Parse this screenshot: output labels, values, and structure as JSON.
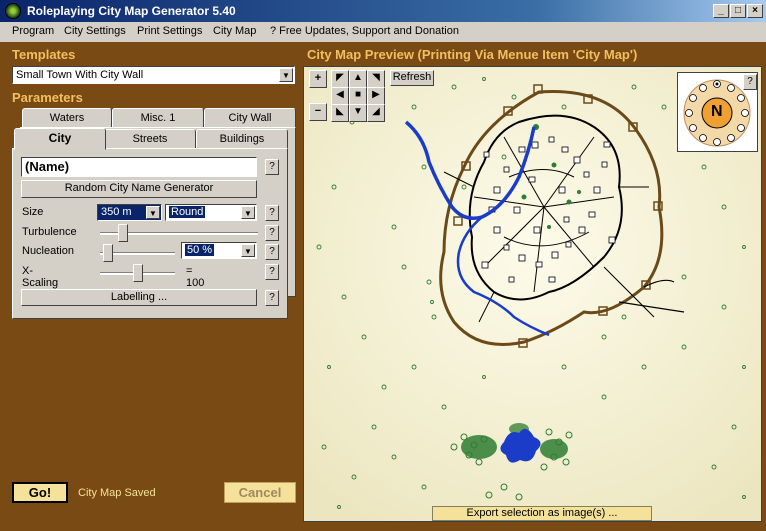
{
  "window": {
    "title": "Roleplaying City Map Generator 5.40",
    "buttons": {
      "minimize": "_",
      "maximize": "□",
      "close": "×"
    }
  },
  "menu": [
    "Program",
    "City Settings",
    "Print Settings",
    "City Map",
    "? Free Updates, Support and Donation"
  ],
  "templates": {
    "heading": "Templates",
    "selected": "Small Town With City Wall"
  },
  "parameters": {
    "heading": "Parameters",
    "tabs_row1": [
      "Waters",
      "Misc. 1",
      "City Wall"
    ],
    "tabs_row2": [
      "City",
      "Streets",
      "Buildings"
    ],
    "active_tab": "City",
    "name_value": "(Name)",
    "random_name_button": "Random City Name Generator",
    "size_label": "Size",
    "size_value": "350 m",
    "shape_value": "Round",
    "turbulence_label": "Turbulence",
    "turbulence_level": 0.12,
    "nucleation_label": "Nucleation",
    "nucleation_level": 0.05,
    "nucleation_value": "50 %",
    "xscaling_label": "X-Scaling",
    "xscaling_level": 0.5,
    "xscaling_value": "= 100 %",
    "labelling_button": "Labelling ...",
    "help_label": "?"
  },
  "preview": {
    "heading": "City Map Preview (Printing Via Menue Item 'City Map')",
    "refresh_label": "Refresh",
    "zoom_in": "+",
    "zoom_out": "−",
    "compass_letter": "N",
    "help_label": "?",
    "export_label": "Export selection as image(s) ..."
  },
  "bottom": {
    "go_label": "Go!",
    "status_text": "City Map Saved",
    "cancel_label": "Cancel"
  },
  "colors": {
    "panel_bg": "#7a4a14",
    "accent_text": "#f0c060",
    "map_bg": "#fbf7e0",
    "wall": "#6b4a1a",
    "river": "#1a3cc8",
    "trees": "#2e7d32"
  }
}
